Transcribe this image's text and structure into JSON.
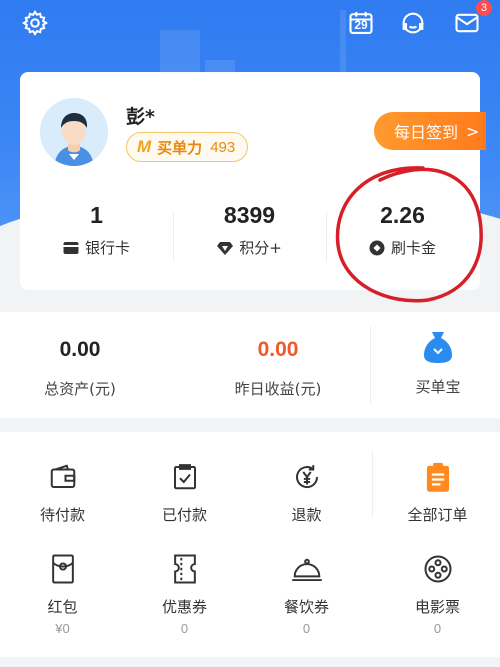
{
  "colors": {
    "header_blue": "#3b86f5",
    "accent_orange": "#ff7a1c",
    "yield_orange": "#f05a28",
    "badge_red": "#ff4d4f"
  },
  "header": {
    "settings_icon": "gear-icon",
    "calendar_day": "29",
    "message_badge": "3"
  },
  "profile": {
    "username": "彭*",
    "membership_logo": "M",
    "membership_label": "买单力",
    "membership_value": "493",
    "signin_label": "每日签到",
    "signin_chevron": ">"
  },
  "stats": [
    {
      "value": "1",
      "label": "银行卡",
      "icon": "bank-card-icon"
    },
    {
      "value": "8399",
      "label": "积分+",
      "icon": "diamond-icon"
    },
    {
      "value": "2.26",
      "label": "刷卡金",
      "icon": "coin-icon"
    }
  ],
  "assets": {
    "total_value": "0.00",
    "total_label": "总资产(元)",
    "yesterday_value": "0.00",
    "yesterday_label": "昨日收益(元)",
    "wallet_label": "买单宝"
  },
  "orders": {
    "row1": [
      {
        "label": "待付款",
        "icon": "wallet-icon"
      },
      {
        "label": "已付款",
        "icon": "clipboard-check-icon"
      },
      {
        "label": "退款",
        "icon": "refund-yen-icon"
      },
      {
        "label": "全部订单",
        "icon": "order-list-icon"
      }
    ],
    "row2": [
      {
        "label": "红包",
        "value": "¥0",
        "icon": "red-envelope-icon"
      },
      {
        "label": "优惠券",
        "value": "0",
        "icon": "ticket-icon"
      },
      {
        "label": "餐饮券",
        "value": "0",
        "icon": "cloche-icon"
      },
      {
        "label": "电影票",
        "value": "0",
        "icon": "film-reel-icon"
      }
    ]
  }
}
